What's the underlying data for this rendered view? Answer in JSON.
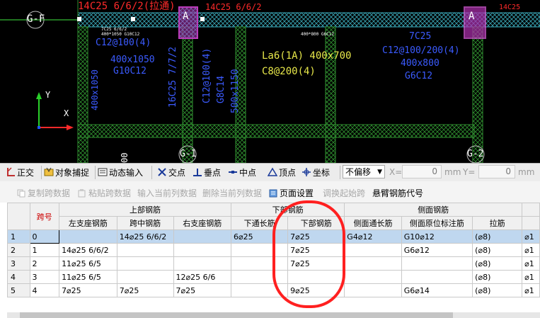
{
  "cad": {
    "top_axis_label": "G-F",
    "top_dim_left": "14C25 6/6/2(拉通)",
    "top_dim_mid": "14C25 6/6/2",
    "top_dim_right": "14C25",
    "small_label_1": "7C25 6/6/2",
    "small_label_2": "400*1050 G10C12",
    "small_label_3": "400*800 G6C12",
    "beam_a_stirrup": "C12@100(4)",
    "beam_a_size": "400x1050",
    "beam_a_side": "G10C12",
    "beam_a_vertical_size": "400x1050",
    "beam_b_vertical_top": "16C25 7/7/2",
    "beam_b_vertical_stirrup": "C12@100(4)",
    "beam_b_vertical_side": "G8C14",
    "beam_b_vertical_size": "500x1150",
    "la6_name": "La6(1A) 400x700",
    "la6_stirrup": "C8@200(4)",
    "beam_c_top": "7C25",
    "beam_c_stirrup": "C12@100/200(4)",
    "beam_c_size": "400x800",
    "beam_c_side": "G6C12",
    "axis_y": "Y",
    "axis_x": "X",
    "bottom_axis_1": "G-1",
    "bottom_axis_2": "G-2",
    "bottom_left_num": "00",
    "column_text": "A"
  },
  "snapbar": {
    "ortho": "正交",
    "object_snap": "对象捕捉",
    "dynamic_input": "动态输入",
    "intersection": "交点",
    "perpendicular": "垂点",
    "midpoint": "中点",
    "vertex": "顶点",
    "coordinate": "坐标",
    "offset_select": "不偏移",
    "x_label": "X=",
    "x_value": "0",
    "x_unit": "mm",
    "y_label": "Y=",
    "y_value": "0",
    "y_unit": "mm"
  },
  "toolbar2": {
    "copy_span": "复制跨数据",
    "paste_span": "粘贴跨数据",
    "input_current_col": "输入当前列数据",
    "delete_current_col": "删除当前列数据",
    "page_setup": "页面设置",
    "swap_start_span": "调换起始跨",
    "cantilever_code": "悬臂钢筋代号"
  },
  "table": {
    "group_headers": {
      "span_no": "跨号",
      "top": "上部钢筋",
      "bottom": "下部钢筋",
      "side": "侧面钢筋"
    },
    "columns": [
      "左支座钢筋",
      "跨中钢筋",
      "右支座钢筋",
      "下通长筋",
      "下部钢筋",
      "侧面通长筋",
      "侧面原位标注筋",
      "拉筋"
    ],
    "rows": [
      {
        "num": "1",
        "span": "0",
        "left": "",
        "mid": "14⌀25 6/6/2",
        "right": "",
        "btm_through": "6⌀25",
        "btm": "7⌀25",
        "side_through": "G4⌀12",
        "side_orig": "G10⌀12",
        "tie": "(⌀8)",
        "extra": "⌀1"
      },
      {
        "num": "2",
        "span": "1",
        "left": "14⌀25 6/6/2",
        "mid": "",
        "right": "",
        "btm_through": "",
        "btm": "7⌀25",
        "side_through": "",
        "side_orig": "G6⌀12",
        "tie": "(⌀8)",
        "extra": "⌀1"
      },
      {
        "num": "3",
        "span": "2",
        "left": "11⌀25 6/5",
        "mid": "",
        "right": "",
        "btm_through": "",
        "btm": "7⌀25",
        "side_through": "",
        "side_orig": "",
        "tie": "(⌀8)",
        "extra": "⌀1"
      },
      {
        "num": "4",
        "span": "3",
        "left": "11⌀25 6/5",
        "mid": "",
        "right": "12⌀25 6/6",
        "btm_through": "",
        "btm": "",
        "side_through": "",
        "side_orig": "",
        "tie": "(⌀8)",
        "extra": "⌀1"
      },
      {
        "num": "5",
        "span": "4",
        "left": "7⌀25",
        "mid": "7⌀25",
        "right": "7⌀25",
        "btm_through": "",
        "btm": "9⌀25",
        "side_through": "",
        "side_orig": "G6⌀14",
        "tie": "(⌀8)",
        "extra": "⌀1"
      }
    ]
  }
}
